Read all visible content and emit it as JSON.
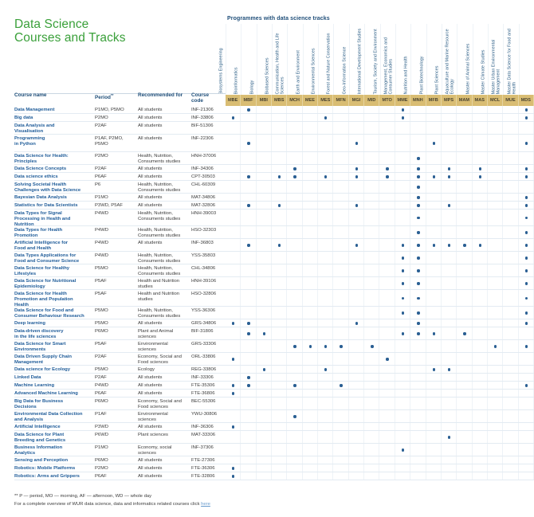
{
  "title_line1": "Data Science",
  "title_line2": "Courses and Tracks",
  "programmes_title": "Programmes with data science tracks",
  "colors": {
    "title_green": "#3aa03a",
    "dot_blue": "#2a5f93",
    "code_band": "#d9bd73",
    "link": "#6699cc"
  },
  "headers": {
    "course_name": "Course name",
    "period": "Period",
    "period_sup": "**",
    "recommended_for": "Recommended for",
    "course_code_line1": "Course",
    "course_code_line2": "code"
  },
  "programmes": [
    {
      "code": "MBE",
      "name": "Biosystems Engineering"
    },
    {
      "code": "MBF",
      "name": "Bioinformatics"
    },
    {
      "code": "MBI",
      "name": "Biology"
    },
    {
      "code": "MBS",
      "name": "Biobased Sciences"
    },
    {
      "code": "MCH",
      "name": "Communication, Health and Life Sciences"
    },
    {
      "code": "MEE",
      "name": "Earth and Environment"
    },
    {
      "code": "MES",
      "name": "Environmental Sciences"
    },
    {
      "code": "MFN",
      "name": "Forest and Nature Conservation"
    },
    {
      "code": "MGI",
      "name": "Geo-Information Science"
    },
    {
      "code": "MID",
      "name": "International Development Studies"
    },
    {
      "code": "MTO",
      "name": "Tourism, Society and Environment"
    },
    {
      "code": "MME",
      "name": "Management, Economics and Consumer Studies"
    },
    {
      "code": "MNH",
      "name": "Nutrition and Health"
    },
    {
      "code": "MFB",
      "name": "Plant Biotechnology"
    },
    {
      "code": "MPS",
      "name": "Plant Sciences"
    },
    {
      "code": "MAM",
      "name": "Aquaculture and Marine Resource Ecology"
    },
    {
      "code": "MAS",
      "name": "Master of Animal Sciences"
    },
    {
      "code": "MCL",
      "name": "Master Climate Studies"
    },
    {
      "code": "MUE",
      "name": "Master Urban Environmental Management"
    },
    {
      "code": "MDS",
      "name": "Master Data Science for Food and Health"
    }
  ],
  "courses": [
    {
      "name": "Data Management",
      "period": "P1MO, P5MO",
      "recommended": "All students",
      "code": "INF-21306",
      "h": 10,
      "tracks": [
        1,
        11,
        19
      ]
    },
    {
      "name": "Big data",
      "period": "P2MO",
      "recommended": "All students",
      "code": "INF-33806",
      "h": 10,
      "tracks": [
        0,
        6,
        11,
        19
      ]
    },
    {
      "name": "Data Analysis and\nVisualisation",
      "period": "P2AF",
      "recommended": "All students",
      "code": "BIF-51306",
      "h": 16,
      "tracks": []
    },
    {
      "name": "Programming\nin Python",
      "period": "P1AF, P2MO,\nP5MO",
      "recommended": "All students",
      "code": "INF-22306",
      "h": 22,
      "tracks": [
        1,
        8,
        13,
        19
      ]
    },
    {
      "name": "Data Science for Health:\nPrinciples",
      "period": "P2MO",
      "recommended": "Health, Nutrition,\nConsuments studies",
      "code": "HNH-37006",
      "h": 16,
      "tracks": [
        12
      ]
    },
    {
      "name": "Data Science Concepts",
      "period": "P2AF",
      "recommended": "All students",
      "code": "INF-34306",
      "h": 10,
      "tracks": [
        4,
        8,
        10,
        12,
        14,
        16,
        19
      ]
    },
    {
      "name": "Data science ethics",
      "period": "P6AF",
      "recommended": "All students",
      "code": "CPT-30503",
      "h": 10,
      "tracks": [
        1,
        3,
        4,
        6,
        8,
        10,
        12,
        13,
        14,
        16,
        19
      ]
    },
    {
      "name": "Solving Societal Health\nChallenges with Data Science",
      "period": "P6",
      "recommended": "Health, Nutrition,\nConsuments studies",
      "code": "CHL-60309",
      "h": 16,
      "tracks": [
        12
      ]
    },
    {
      "name": "Bayesian Data Analysis",
      "period": "P1MO",
      "recommended": "All students",
      "code": "MAT-34806",
      "h": 10,
      "tracks": [
        12,
        19
      ]
    },
    {
      "name": "Statistics for Data Scientists",
      "period": "P3WD, P5AF",
      "recommended": "All students",
      "code": "MAT-32806",
      "h": 10,
      "tracks": [
        1,
        3,
        8,
        12,
        14,
        19
      ]
    },
    {
      "name": "Data Types for Signal\nProcessing in Health and\nNutrition",
      "period": "P4WD",
      "recommended": "Health, Nutrition,\nConsuments studies",
      "code": "HNH-39003",
      "h": 21,
      "tracks": [
        12,
        19
      ]
    },
    {
      "name": "Data Types for Health\nPromotion",
      "period": "P4WD",
      "recommended": "Health, Nutrition,\nConsuments studies",
      "code": "HSO-32303",
      "h": 16,
      "tracks": [
        12,
        19
      ]
    },
    {
      "name": "Artificial Intelligence for\nFood and Health",
      "period": "P4WD",
      "recommended": "All students",
      "code": "INF-36803",
      "h": 16,
      "tracks": [
        1,
        3,
        8,
        11,
        12,
        13,
        14,
        15,
        16,
        19
      ]
    },
    {
      "name": "Data Types Applications for\nFood and Consumer Science",
      "period": "P4WD",
      "recommended": "Health, Nutrition,\nConsuments studies",
      "code": "YSS-35803",
      "h": 16,
      "tracks": [
        11,
        12,
        19
      ]
    },
    {
      "name": "Data Science for Healthy\nLifestyles",
      "period": "P5MO",
      "recommended": "Health, Nutrition,\nConsuments studies",
      "code": "CHL-34806",
      "h": 16,
      "tracks": [
        11,
        12,
        19
      ]
    },
    {
      "name": "Data Science for Nutritional\nEpidemiology",
      "period": "P5AF",
      "recommended": "Health and Nutrition\nstudies",
      "code": "HNH-39106",
      "h": 16,
      "tracks": [
        11,
        12,
        19
      ]
    },
    {
      "name": "Data Science for Health\nPromotion and Population\nHealth",
      "period": "P5AF",
      "recommended": "Health and Nutrition\nstudies",
      "code": "HSO-32806",
      "h": 21,
      "tracks": [
        11,
        12,
        19
      ]
    },
    {
      "name": "Data Science for Food and\nConsumer Behaviour Research",
      "period": "P5MO",
      "recommended": "Health, Nutrition,\nConsuments studies",
      "code": "YSS-36306",
      "h": 16,
      "tracks": [
        11,
        12,
        19
      ]
    },
    {
      "name": "Deep learning",
      "period": "P5MO",
      "recommended": "All students",
      "code": "GRS-34806",
      "h": 10,
      "tracks": [
        0,
        1,
        8,
        12,
        19
      ]
    },
    {
      "name": "Data-driven discovery\nin the life sciences",
      "period": "P6MO",
      "recommended": "Plant and Animal\nsciences",
      "code": "BIF-31806",
      "h": 16,
      "tracks": [
        1,
        2,
        11,
        12,
        13,
        15
      ]
    },
    {
      "name": "Data Science for Smart\nEnvironments",
      "period": "P5AF",
      "recommended": "Environmental\nsciences",
      "code": "GRS-33306",
      "h": 16,
      "tracks": [
        4,
        5,
        6,
        7,
        9,
        17,
        19
      ]
    },
    {
      "name": "Data Driven Supply Chain\nManagement",
      "period": "P2AF",
      "recommended": "Economy, Social and\nFood sciences",
      "code": "ORL-33806",
      "h": 16,
      "tracks": [
        0,
        10
      ]
    },
    {
      "name": "Data science for Ecology",
      "period": "P5MO",
      "recommended": "Ecology",
      "code": "REG-33806",
      "h": 10,
      "tracks": [
        2,
        6,
        13,
        14
      ]
    },
    {
      "name": "Linked Data",
      "period": "P2AF",
      "recommended": "All students",
      "code": "INF-33306",
      "h": 10,
      "tracks": [
        1
      ]
    },
    {
      "name": "Machine Learning",
      "period": "P4WD",
      "recommended": "All students",
      "code": "FTE-35306",
      "h": 10,
      "tracks": [
        0,
        1,
        4,
        7,
        19
      ]
    },
    {
      "name": "Advanced Machine Learning",
      "period": "P6AF",
      "recommended": "All students",
      "code": "FTE-36806",
      "h": 10,
      "tracks": [
        0
      ]
    },
    {
      "name": "Big Data for Business\nDecisions",
      "period": "P6MO",
      "recommended": "Economy, Social and\nFood sciences",
      "code": "BEC-55306",
      "h": 16,
      "tracks": []
    },
    {
      "name": "Environmental Data Collection\nand Analysis",
      "period": "P1AF",
      "recommended": "Environmental\nsciences",
      "code": "YWU-30806",
      "h": 16,
      "tracks": [
        4
      ]
    },
    {
      "name": "Artificial Intelligence",
      "period": "P3WD",
      "recommended": "All students",
      "code": "INF-36306",
      "h": 10,
      "tracks": [
        0
      ]
    },
    {
      "name": "Data Science for Plant\nBreeding and Genetics",
      "period": "P6WD",
      "recommended": "Plant sciences",
      "code": "MAT-33306",
      "h": 16,
      "tracks": [
        14
      ]
    },
    {
      "name": "Business Information\nAnalytics",
      "period": "P1MO",
      "recommended": "Economy, social\nsciences",
      "code": "INF-37306",
      "h": 16,
      "tracks": [
        11
      ]
    },
    {
      "name": "Sensing and Perception",
      "period": "P6MO",
      "recommended": "All students",
      "code": "FTE-27306",
      "h": 10,
      "tracks": []
    },
    {
      "name": "Robotics: Mobile Platforms",
      "period": "P2MO",
      "recommended": "All students",
      "code": "FTE-36306",
      "h": 10,
      "tracks": [
        0
      ]
    },
    {
      "name": "Robotics: Arms and Grippers",
      "period": "P6AF",
      "recommended": "All students",
      "code": "FTE-32806",
      "h": 10,
      "tracks": [
        0
      ]
    }
  ],
  "footer": {
    "legend": "** P — period, MO — morning, AF — afternoon, WD — whole day",
    "overview_text": "For a complete overview of WUR data science, data and informatics related courses click ",
    "link_text": "here"
  }
}
